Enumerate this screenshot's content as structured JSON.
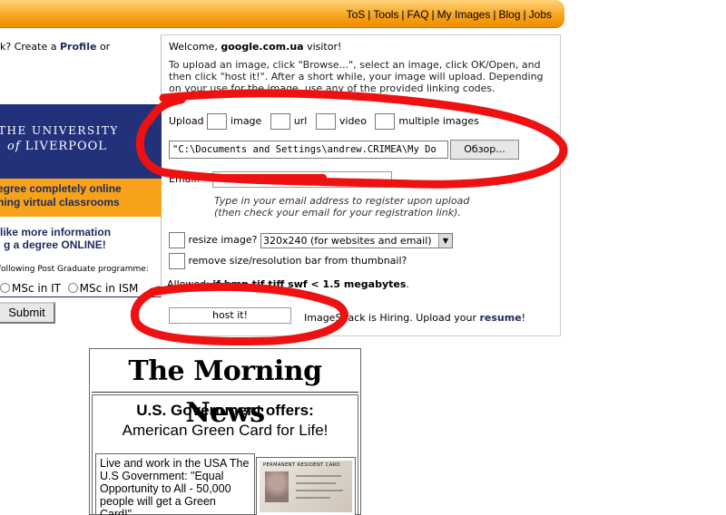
{
  "nav": {
    "links": [
      "ToS",
      "Tools",
      "FAQ",
      "My Images",
      "Blog",
      "Jobs"
    ],
    "separator": "|"
  },
  "left": {
    "login_prefix": "k? Create a",
    "login_profile": "Profile",
    "login_suffix": "or",
    "uni_line1": "THE UNIVERSITY",
    "uni_of": "of",
    "uni_line2": "LIVERPOOL",
    "promo_line1": "egree completely online",
    "promo_line2": "ning virtual classrooms",
    "more_line1": "like more information",
    "more_line2": "g a degree ONLINE!",
    "programme_text": "following Post Graduate programme:",
    "radio1": "MSc in IT",
    "radio2": "MSc in ISM",
    "submit_label": "Submit"
  },
  "main": {
    "welcome_prefix": "Welcome,",
    "welcome_host": "google.com.ua",
    "welcome_suffix": "visitor!",
    "instructions": "To upload an image, click \"Browse...\", select an image, click OK/Open, and then click \"host it!\". After a short while, your image will upload. Depending on your use for the image, use any of the provided linking codes.",
    "type_prefix": "Upload",
    "type_image": "image",
    "type_url": "url",
    "type_video": "video",
    "type_multiple": "multiple images",
    "file_value": "\"C:\\Documents and Settings\\andrew.CRIMEA\\My Do",
    "browse_label": "Обзор...",
    "email_label": "Email:",
    "email_hint_line1": "Type in your email address to register upon upload",
    "email_hint_line2": "(then check your email for your registration link).",
    "resize_label": "resize image?",
    "resize_value": "320x240 (for websites and email)",
    "remove_label": "remove size/resolution bar from thumbnail?",
    "formats_prefix": "Allowed:",
    "formats_bold": "if bmp tif tiff swf < 1.5 megabytes",
    "formats_end": ".",
    "host_label": "host it!",
    "hiring_text": "ImageShack is Hiring. Upload your",
    "hiring_link": "resume",
    "hiring_end": "!"
  },
  "ad": {
    "masthead": "The Morning News",
    "headline1": "U.S. Government offers:",
    "headline2": "American Green Card for Life!",
    "body": "Live and work in the USA The U.S Government: \"Equal Opportunity to All - 50,000 people will get a Green Card!\"",
    "card_title": "PERMANENT RESIDENT CARD"
  },
  "colors": {
    "nav_orange": "#f7a21b",
    "uni_navy": "#23307a",
    "annotation_red": "#ee1111"
  }
}
